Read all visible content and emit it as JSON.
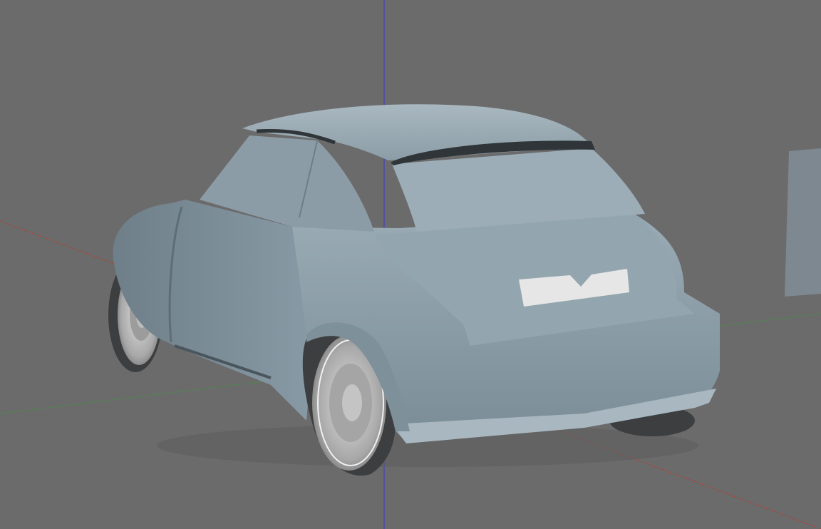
{
  "viewport": {
    "background_color": "#6b6b6b",
    "axes": {
      "x_color": "#c0392b",
      "y_color": "#3a9a3a",
      "z_color": "#3a3ad0"
    },
    "model": {
      "name": "car",
      "body_color": "#8ea0ab",
      "glass_color": "#93a3ad",
      "spoiler_color": "#2f3538",
      "license_plate_color": "#e6e6e6",
      "tire_color": "#3c3e40",
      "rim_color": "#c9c9c9"
    },
    "backdrop_panel_color": "#7d8890"
  }
}
